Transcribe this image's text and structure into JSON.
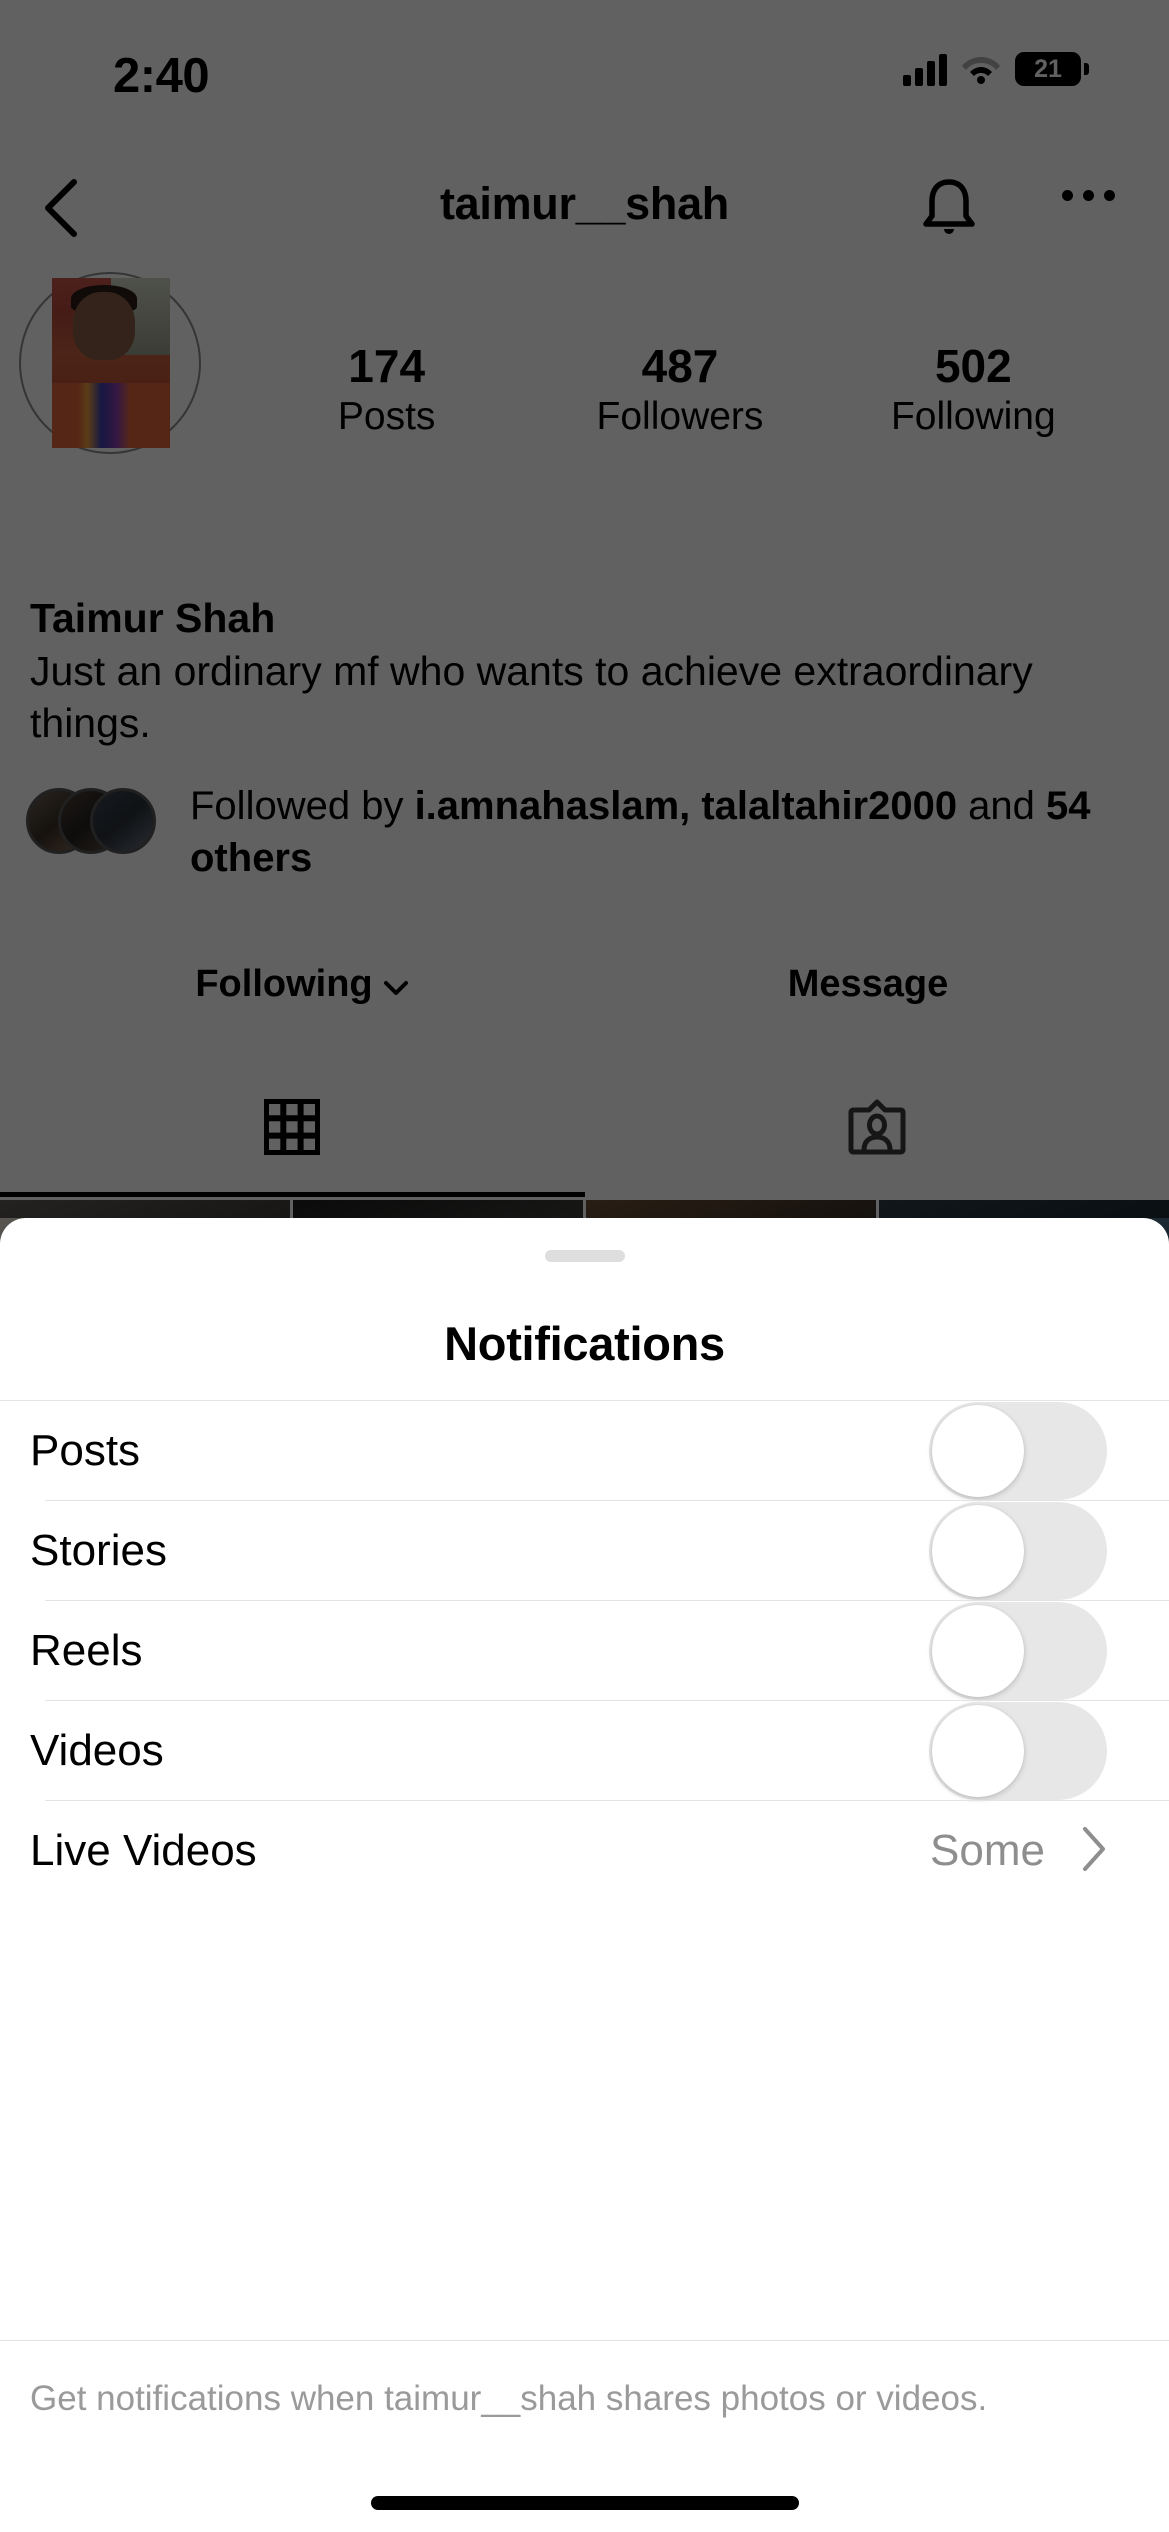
{
  "status_bar": {
    "time": "2:40",
    "battery_percent": "21",
    "signal_icon": "cellular-signal-icon",
    "wifi_icon": "wifi-icon"
  },
  "nav": {
    "back_icon": "chevron-left-icon",
    "title": "taimur__shah",
    "bell_icon": "bell-icon",
    "more_icon": "ellipsis-icon"
  },
  "profile": {
    "avatar_alt": "profile-photo",
    "display_name": "Taimur Shah",
    "bio": "Just an ordinary mf who wants to achieve extraordinary things.",
    "stats": [
      {
        "value": "174",
        "label": "Posts"
      },
      {
        "value": "487",
        "label": "Followers"
      },
      {
        "value": "502",
        "label": "Following"
      }
    ],
    "followed_by": {
      "prefix": "Followed by ",
      "names": "i.amnahaslam, talaltahir2000",
      "middle": " and ",
      "others": "54 others"
    },
    "actions": {
      "following_label": "Following",
      "following_chevron": "chevron-down-icon",
      "message_label": "Message"
    },
    "tabs": [
      {
        "name": "grid-tab",
        "icon": "grid-icon",
        "active": true
      },
      {
        "name": "tagged-tab",
        "icon": "tagged-person-icon",
        "active": false
      }
    ]
  },
  "sheet": {
    "grabber": "drag-handle",
    "title": "Notifications",
    "rows": [
      {
        "label": "Posts",
        "type": "toggle",
        "on": false
      },
      {
        "label": "Stories",
        "type": "toggle",
        "on": false
      },
      {
        "label": "Reels",
        "type": "toggle",
        "on": false
      },
      {
        "label": "Videos",
        "type": "toggle",
        "on": false
      },
      {
        "label": "Live Videos",
        "type": "link",
        "value": "Some",
        "chevron": "chevron-right-icon"
      }
    ],
    "footer": "Get notifications when taimur__shah shares photos or videos."
  },
  "home_indicator": "home-indicator",
  "colors": {
    "accent": "#2f8fe6",
    "sheet_bg": "#ffffff",
    "dim_overlay": "#565656",
    "toggle_off_track": "#e7e7e7",
    "muted_text": "#8e8e8e"
  }
}
